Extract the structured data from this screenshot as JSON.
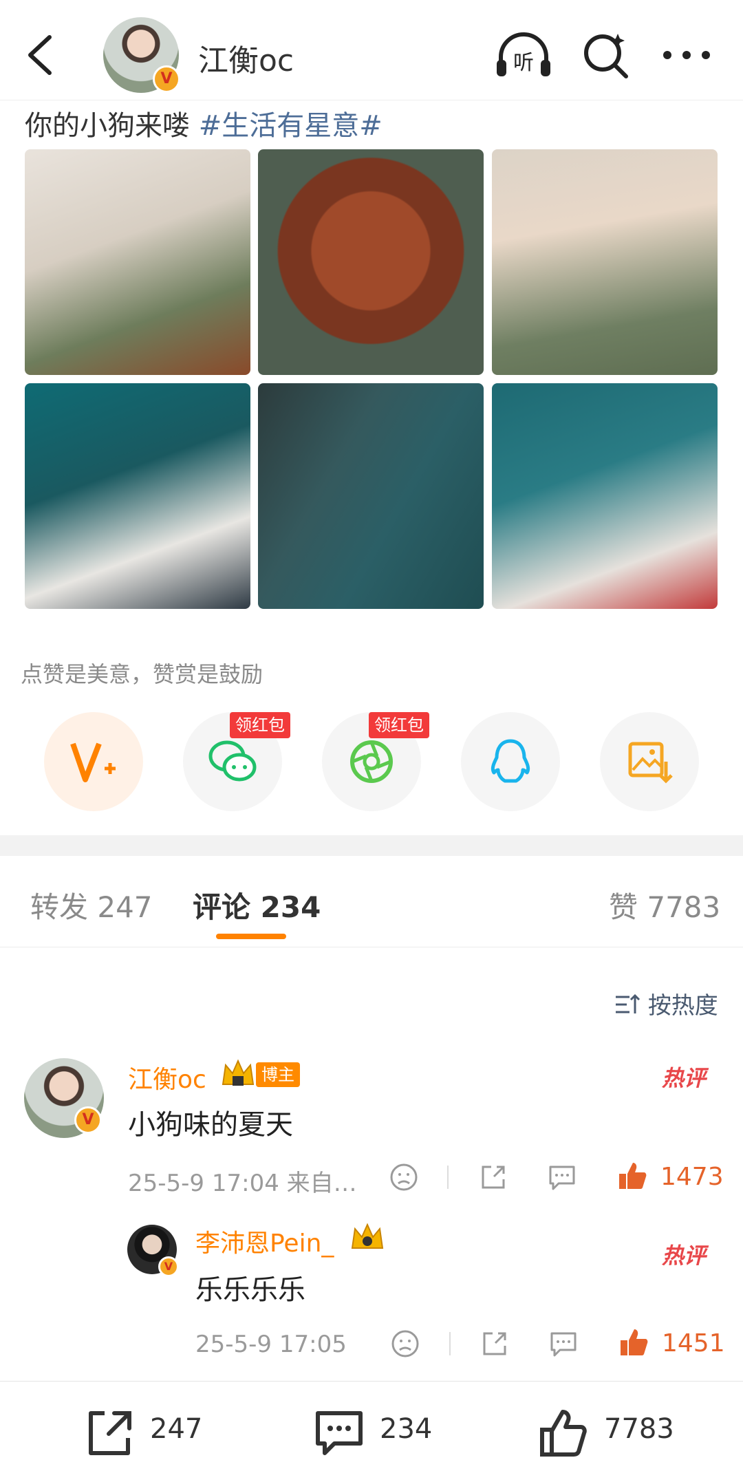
{
  "header": {
    "back_icon": "chevron-left-icon",
    "name": "江衡oc",
    "listen_label": "听",
    "search_icon": "search-sparkle-icon",
    "more_icon": "more-dots-icon"
  },
  "post": {
    "text": "你的小狗来喽 ",
    "hashtag": "#生活有星意#",
    "photo_count": 6
  },
  "reward": {
    "prompt": "点赞是美意，赞赏是鼓励",
    "share_targets": [
      {
        "name": "v-plus",
        "badge": ""
      },
      {
        "name": "wechat",
        "badge": "领红包"
      },
      {
        "name": "moments",
        "badge": "领红包"
      },
      {
        "name": "qq",
        "badge": ""
      },
      {
        "name": "save-image",
        "badge": ""
      }
    ]
  },
  "tabs": {
    "repost": "转发 247",
    "comments": "评论 234",
    "likes": "赞 7783"
  },
  "sort": {
    "label": "按热度"
  },
  "comments": [
    {
      "name": "江衡oc",
      "badge": "博主",
      "hot": "热评",
      "text": "小狗味的夏天",
      "meta": "25-5-9 17:04 来自…",
      "likes": "1473"
    },
    {
      "name": "李沛恩Pein_",
      "hot": "热评",
      "text": "乐乐乐乐",
      "meta": "25-5-9 17:05",
      "likes": "1451"
    }
  ],
  "bottom_bar": {
    "reposts": "247",
    "comments": "234",
    "likes": "7783"
  },
  "colors": {
    "accent": "#ff8200",
    "hashtag": "#4d6d97",
    "red_badge": "#f23a3a",
    "like": "#e5632a"
  }
}
